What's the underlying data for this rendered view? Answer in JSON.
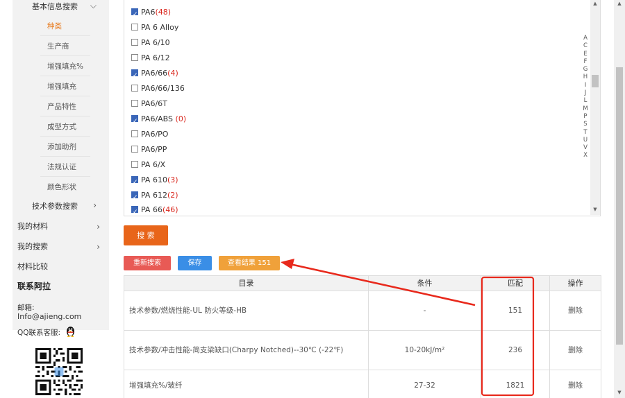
{
  "sidebar": {
    "section_title": "基本信息搜索",
    "sub_items": [
      {
        "label": "种类",
        "active": true
      },
      {
        "label": "生产商",
        "active": false
      },
      {
        "label": "增强填充%",
        "active": false
      },
      {
        "label": "增强填充",
        "active": false
      },
      {
        "label": "产品特性",
        "active": false
      },
      {
        "label": "成型方式",
        "active": false
      },
      {
        "label": "添加助剂",
        "active": false
      },
      {
        "label": "法规认证",
        "active": false
      },
      {
        "label": "颜色形状",
        "active": false
      }
    ],
    "tech_search": "技术参数搜索",
    "my_materials": "我的材料",
    "my_searches": "我的搜索",
    "compare": "材料比较",
    "contact_title": "联系阿拉",
    "email_label": "邮箱:",
    "email": "Info@ajieng.com",
    "qq_label": "QQ联系客服:"
  },
  "options": [
    {
      "name": "PA6",
      "count": "(48)",
      "checked": true
    },
    {
      "name": "PA 6 Alloy",
      "count": "",
      "checked": false
    },
    {
      "name": "PA 6/10",
      "count": "",
      "checked": false
    },
    {
      "name": "PA 6/12",
      "count": "",
      "checked": false
    },
    {
      "name": "PA6/66",
      "count": "(4)",
      "checked": true
    },
    {
      "name": "PA6/66/136",
      "count": "",
      "checked": false
    },
    {
      "name": "PA6/6T",
      "count": "",
      "checked": false
    },
    {
      "name": "PA6/ABS ",
      "count": "(0)",
      "checked": true
    },
    {
      "name": "PA6/PO",
      "count": "",
      "checked": false
    },
    {
      "name": "PA6/PP",
      "count": "",
      "checked": false
    },
    {
      "name": "PA 6/X",
      "count": "",
      "checked": false
    },
    {
      "name": "PA 610",
      "count": "(3)",
      "checked": true
    },
    {
      "name": "PA 612",
      "count": "(2)",
      "checked": true
    },
    {
      "name": "PA 66",
      "count": "(46)",
      "checked": true
    }
  ],
  "alphabet": [
    "A",
    "C",
    "E",
    "F",
    "G",
    "H",
    "I",
    "J",
    "L",
    "M",
    "P",
    "S",
    "T",
    "U",
    "V",
    "X"
  ],
  "buttons": {
    "search": "搜 索",
    "reset": "重新搜索",
    "save": "保存",
    "results": "查看结果 151"
  },
  "table": {
    "headers": [
      "目录",
      "条件",
      "匹配",
      "操作"
    ],
    "rows": [
      {
        "catalog": "技术参数/燃烧性能-UL 防火等级-HB",
        "condition": "-",
        "match": "151",
        "action": "删除"
      },
      {
        "catalog": "技术参数/冲击性能-简支梁缺口(Charpy Notched)--30℃ (-22℉)",
        "condition": "10-20kJ/m²",
        "match": "236",
        "action": "删除"
      },
      {
        "catalog": "增强填充%/玻纤",
        "condition": "27-32",
        "match": "1821",
        "action": "删除"
      }
    ]
  },
  "colors": {
    "accent_orange": "#e8651a",
    "reset_red": "#e85a55",
    "save_blue": "#3a8ee6",
    "results_orange": "#f0a13a",
    "annotation_red": "#e8291c",
    "count_red": "#d9261c"
  }
}
